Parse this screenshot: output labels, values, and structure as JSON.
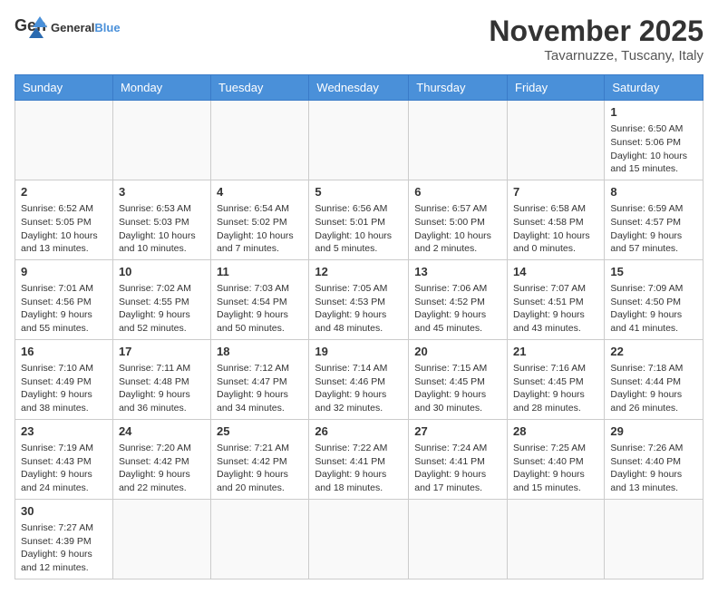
{
  "header": {
    "logo_general": "General",
    "logo_blue": "Blue",
    "month_year": "November 2025",
    "location": "Tavarnuzze, Tuscany, Italy"
  },
  "days_of_week": [
    "Sunday",
    "Monday",
    "Tuesday",
    "Wednesday",
    "Thursday",
    "Friday",
    "Saturday"
  ],
  "weeks": [
    [
      {
        "day": "",
        "info": ""
      },
      {
        "day": "",
        "info": ""
      },
      {
        "day": "",
        "info": ""
      },
      {
        "day": "",
        "info": ""
      },
      {
        "day": "",
        "info": ""
      },
      {
        "day": "",
        "info": ""
      },
      {
        "day": "1",
        "info": "Sunrise: 6:50 AM\nSunset: 5:06 PM\nDaylight: 10 hours and 15 minutes."
      }
    ],
    [
      {
        "day": "2",
        "info": "Sunrise: 6:52 AM\nSunset: 5:05 PM\nDaylight: 10 hours and 13 minutes."
      },
      {
        "day": "3",
        "info": "Sunrise: 6:53 AM\nSunset: 5:03 PM\nDaylight: 10 hours and 10 minutes."
      },
      {
        "day": "4",
        "info": "Sunrise: 6:54 AM\nSunset: 5:02 PM\nDaylight: 10 hours and 7 minutes."
      },
      {
        "day": "5",
        "info": "Sunrise: 6:56 AM\nSunset: 5:01 PM\nDaylight: 10 hours and 5 minutes."
      },
      {
        "day": "6",
        "info": "Sunrise: 6:57 AM\nSunset: 5:00 PM\nDaylight: 10 hours and 2 minutes."
      },
      {
        "day": "7",
        "info": "Sunrise: 6:58 AM\nSunset: 4:58 PM\nDaylight: 10 hours and 0 minutes."
      },
      {
        "day": "8",
        "info": "Sunrise: 6:59 AM\nSunset: 4:57 PM\nDaylight: 9 hours and 57 minutes."
      }
    ],
    [
      {
        "day": "9",
        "info": "Sunrise: 7:01 AM\nSunset: 4:56 PM\nDaylight: 9 hours and 55 minutes."
      },
      {
        "day": "10",
        "info": "Sunrise: 7:02 AM\nSunset: 4:55 PM\nDaylight: 9 hours and 52 minutes."
      },
      {
        "day": "11",
        "info": "Sunrise: 7:03 AM\nSunset: 4:54 PM\nDaylight: 9 hours and 50 minutes."
      },
      {
        "day": "12",
        "info": "Sunrise: 7:05 AM\nSunset: 4:53 PM\nDaylight: 9 hours and 48 minutes."
      },
      {
        "day": "13",
        "info": "Sunrise: 7:06 AM\nSunset: 4:52 PM\nDaylight: 9 hours and 45 minutes."
      },
      {
        "day": "14",
        "info": "Sunrise: 7:07 AM\nSunset: 4:51 PM\nDaylight: 9 hours and 43 minutes."
      },
      {
        "day": "15",
        "info": "Sunrise: 7:09 AM\nSunset: 4:50 PM\nDaylight: 9 hours and 41 minutes."
      }
    ],
    [
      {
        "day": "16",
        "info": "Sunrise: 7:10 AM\nSunset: 4:49 PM\nDaylight: 9 hours and 38 minutes."
      },
      {
        "day": "17",
        "info": "Sunrise: 7:11 AM\nSunset: 4:48 PM\nDaylight: 9 hours and 36 minutes."
      },
      {
        "day": "18",
        "info": "Sunrise: 7:12 AM\nSunset: 4:47 PM\nDaylight: 9 hours and 34 minutes."
      },
      {
        "day": "19",
        "info": "Sunrise: 7:14 AM\nSunset: 4:46 PM\nDaylight: 9 hours and 32 minutes."
      },
      {
        "day": "20",
        "info": "Sunrise: 7:15 AM\nSunset: 4:45 PM\nDaylight: 9 hours and 30 minutes."
      },
      {
        "day": "21",
        "info": "Sunrise: 7:16 AM\nSunset: 4:45 PM\nDaylight: 9 hours and 28 minutes."
      },
      {
        "day": "22",
        "info": "Sunrise: 7:18 AM\nSunset: 4:44 PM\nDaylight: 9 hours and 26 minutes."
      }
    ],
    [
      {
        "day": "23",
        "info": "Sunrise: 7:19 AM\nSunset: 4:43 PM\nDaylight: 9 hours and 24 minutes."
      },
      {
        "day": "24",
        "info": "Sunrise: 7:20 AM\nSunset: 4:42 PM\nDaylight: 9 hours and 22 minutes."
      },
      {
        "day": "25",
        "info": "Sunrise: 7:21 AM\nSunset: 4:42 PM\nDaylight: 9 hours and 20 minutes."
      },
      {
        "day": "26",
        "info": "Sunrise: 7:22 AM\nSunset: 4:41 PM\nDaylight: 9 hours and 18 minutes."
      },
      {
        "day": "27",
        "info": "Sunrise: 7:24 AM\nSunset: 4:41 PM\nDaylight: 9 hours and 17 minutes."
      },
      {
        "day": "28",
        "info": "Sunrise: 7:25 AM\nSunset: 4:40 PM\nDaylight: 9 hours and 15 minutes."
      },
      {
        "day": "29",
        "info": "Sunrise: 7:26 AM\nSunset: 4:40 PM\nDaylight: 9 hours and 13 minutes."
      }
    ],
    [
      {
        "day": "30",
        "info": "Sunrise: 7:27 AM\nSunset: 4:39 PM\nDaylight: 9 hours and 12 minutes."
      },
      {
        "day": "",
        "info": ""
      },
      {
        "day": "",
        "info": ""
      },
      {
        "day": "",
        "info": ""
      },
      {
        "day": "",
        "info": ""
      },
      {
        "day": "",
        "info": ""
      },
      {
        "day": "",
        "info": ""
      }
    ]
  ]
}
